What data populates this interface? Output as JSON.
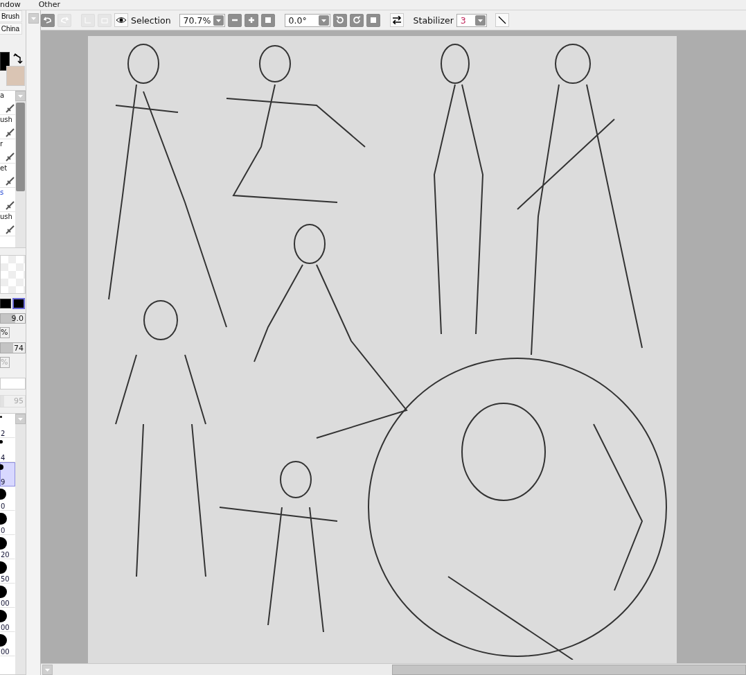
{
  "menu": [
    {
      "label": "ndow"
    },
    {
      "label": "Other"
    }
  ],
  "toolbar": {
    "selection_label": "Selection",
    "zoom": "70.7%",
    "rotation": "0.0°",
    "stabilizer_label": "Stabilizer",
    "stabilizer": "3"
  },
  "left_panel": {
    "brush_tabs": [
      {
        "label": "Brush"
      },
      {
        "label": "China"
      }
    ],
    "tools": [
      {
        "label": "a",
        "selected": false
      },
      {
        "label": "ush",
        "selected": false
      },
      {
        "label": "r",
        "selected": false
      },
      {
        "label": "et",
        "selected": false
      },
      {
        "label": "s",
        "selected": true
      },
      {
        "label": "ush",
        "selected": false
      }
    ],
    "size_slider": {
      "reading": "9.0",
      "level": 0.6
    },
    "percent_1": "%",
    "density_slider": {
      "reading": "74",
      "level": 0.5
    },
    "percent_2": "%",
    "slider_3": {
      "reading": "95",
      "level": 0.15
    },
    "brush_sizes": [
      {
        "label": "2",
        "selected": false
      },
      {
        "label": "4",
        "selected": false
      },
      {
        "label": "9",
        "selected": true
      },
      {
        "label": "0",
        "selected": false
      },
      {
        "label": "0",
        "selected": false
      },
      {
        "label": "20",
        "selected": false
      },
      {
        "label": "50",
        "selected": false
      },
      {
        "label": "00",
        "selected": false
      },
      {
        "label": "00",
        "selected": false
      },
      {
        "label": "00",
        "selected": false
      }
    ]
  }
}
